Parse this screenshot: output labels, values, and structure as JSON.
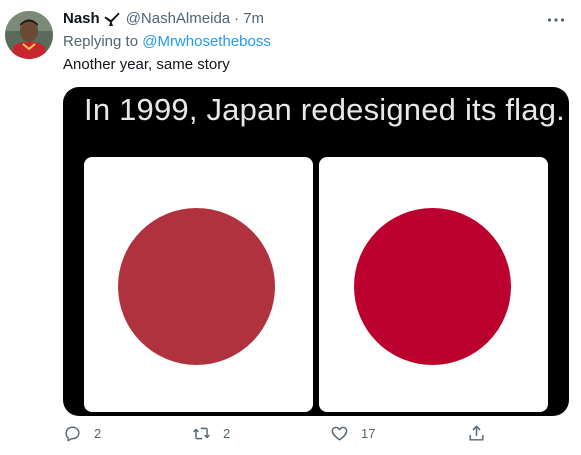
{
  "tweet": {
    "display_name": "Nash",
    "handle": "@NashAlmeida",
    "separator": "·",
    "time": "7m",
    "replying_prefix": "Replying to",
    "replying_to": "@Mrwhosetheboss",
    "text": "Another year, same story"
  },
  "media": {
    "caption": "In 1999, Japan redesigned its flag.",
    "old_disc_color": "#b0323f",
    "new_disc_color": "#bc002d"
  },
  "actions": {
    "reply_count": "2",
    "retweet_count": "2",
    "like_count": "17",
    "share_count": ""
  },
  "colors": {
    "accent": "#1d9bf0",
    "secondary_text": "#536471"
  }
}
